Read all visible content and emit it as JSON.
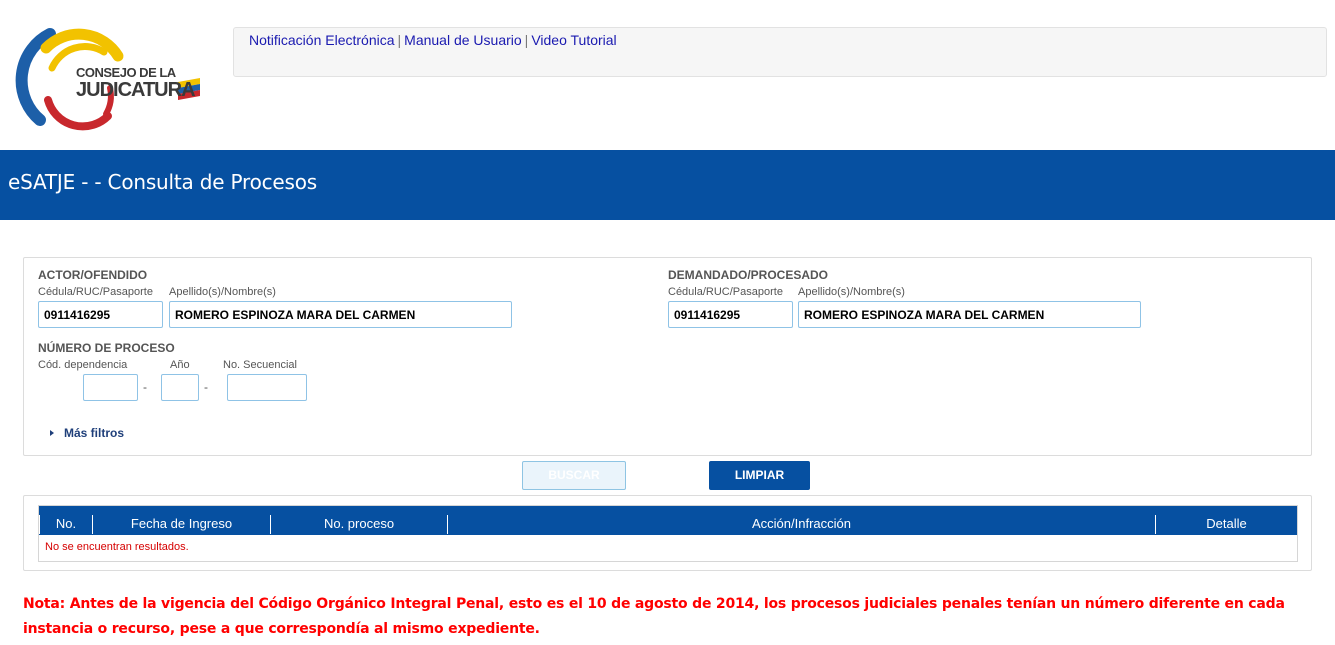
{
  "logo": {
    "line1": "CONSEJO DE LA",
    "line2": "JUDICATURA"
  },
  "toplinks": [
    {
      "label": "Notificación Electrónica"
    },
    {
      "label": "Manual de Usuario"
    },
    {
      "label": "Video Tutorial"
    }
  ],
  "separator": "|",
  "page_title": "eSATJE - - Consulta de Procesos",
  "actor": {
    "title": "ACTOR/OFENDIDO",
    "id_label": "Cédula/RUC/Pasaporte",
    "name_label": "Apellido(s)/Nombre(s)",
    "id_value": "0911416295",
    "name_value": "ROMERO ESPINOZA MARA DEL CARMEN"
  },
  "demandado": {
    "title": "DEMANDADO/PROCESADO",
    "id_label": "Cédula/RUC/Pasaporte",
    "name_label": "Apellido(s)/Nombre(s)",
    "id_value": "0911416295",
    "name_value": "ROMERO ESPINOZA MARA DEL CARMEN"
  },
  "proceso": {
    "title": "NÚMERO DE PROCESO",
    "dep_label": "Cód. dependencia",
    "year_label": "Año",
    "seq_label": "No. Secuencial",
    "dep_value": "",
    "year_value": "",
    "seq_value": "",
    "dash": "-"
  },
  "more_filters": "Más filtros",
  "buttons": {
    "search": "BUSCAR",
    "clear": "LIMPIAR"
  },
  "table": {
    "headers": [
      "No.",
      "Fecha de Ingreso",
      "No. proceso",
      "Acción/Infracción",
      "Detalle"
    ],
    "empty_message": "No se encuentran resultados."
  },
  "note": "Nota: Antes de la vigencia del Código Orgánico Integral Penal, esto es el 10 de agosto de 2014, los procesos judiciales penales tenían un número diferente en cada instancia o recurso, pese a que correspondía al mismo expediente.",
  "colors": {
    "brand_blue": "#0650a1",
    "note_red": "#ff0000",
    "link_blue": "#1a1ab0"
  }
}
